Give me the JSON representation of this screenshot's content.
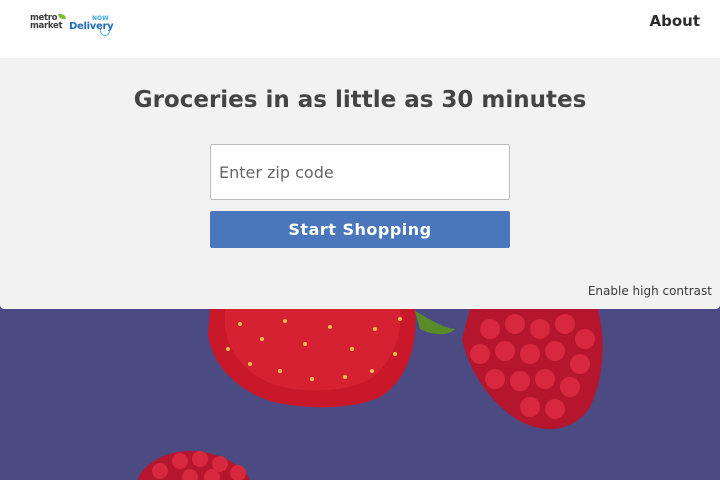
{
  "header": {
    "logo": {
      "line1": "metro",
      "line2": "market",
      "word": "Delivery",
      "badge": "NOW"
    },
    "nav_about": "About"
  },
  "hero": {
    "title": "Groceries in as little as 30 minutes",
    "zip_placeholder": "Enter zip code",
    "zip_value": "",
    "start_button": "Start Shopping",
    "high_contrast_link": "Enable high contrast"
  },
  "colors": {
    "header_bg": "#ffffff",
    "panel_bg": "#f2f2f2",
    "button_bg": "#4a76bb",
    "background_purple": "#4c4a83",
    "brand_blue": "#1e6ab8",
    "brand_green": "#7cbb32"
  },
  "images": {
    "background": "strawberry-and-raspberries"
  }
}
